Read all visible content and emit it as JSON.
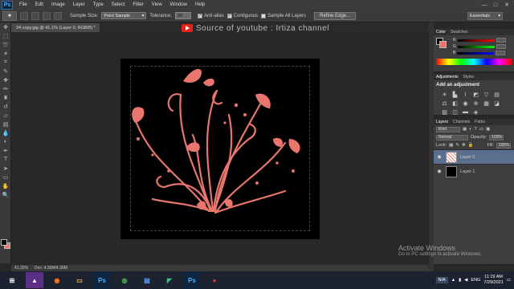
{
  "app": {
    "logo": "Ps"
  },
  "menu": [
    "File",
    "Edit",
    "Image",
    "Layer",
    "Type",
    "Select",
    "Filter",
    "View",
    "Window",
    "Help"
  ],
  "window_controls": {
    "minimize": "—",
    "maximize": "□",
    "close": "✕"
  },
  "options_bar": {
    "sample_size_label": "Sample Size:",
    "sample_size_value": "Point Sample",
    "tolerance_label": "Tolerance:",
    "tolerance_value": "20",
    "anti_alias_label": "Anti-alias",
    "contiguous_label": "Contiguous",
    "sample_all_layers_label": "Sample All Layers",
    "refine_edge_label": "Refine Edge...",
    "workspace": "Essentials"
  },
  "document_tab": "24 copy.jpg @ 41.1% (Layer 0, RGB/8) *",
  "overlay": {
    "source_text": "Source of youtube : Irtiza channel"
  },
  "status_bar": {
    "zoom": "41.32%",
    "doc": "Doc: 4.36M/4.36M"
  },
  "panels": {
    "color": {
      "tabs": [
        "Color",
        "Swatches"
      ],
      "channels": [
        "R",
        "G",
        "B"
      ]
    },
    "adjustments": {
      "tabs": [
        "Adjustments",
        "Styles"
      ],
      "title": "Add an adjustment"
    },
    "layers": {
      "tabs": [
        "Layers",
        "Channels",
        "Paths"
      ],
      "kind_label": "Kind",
      "blend_mode": "Normal",
      "opacity_label": "Opacity:",
      "opacity_value": "100%",
      "lock_label": "Lock:",
      "fill_label": "Fill:",
      "fill_value": "100%",
      "items": [
        {
          "name": "Layer 0",
          "selected": true
        },
        {
          "name": "Layer 1",
          "selected": false
        }
      ]
    }
  },
  "watermark": {
    "line1": "Activate Windows",
    "line2": "Go to PC settings to activate Windows."
  },
  "taskbar": {
    "input_lang": "N/A",
    "lang": "ENG",
    "time": "11:19 AM",
    "date": "7/29/2021"
  },
  "colors": {
    "artwork": "#e8766c",
    "canvas_bg": "#000000"
  }
}
